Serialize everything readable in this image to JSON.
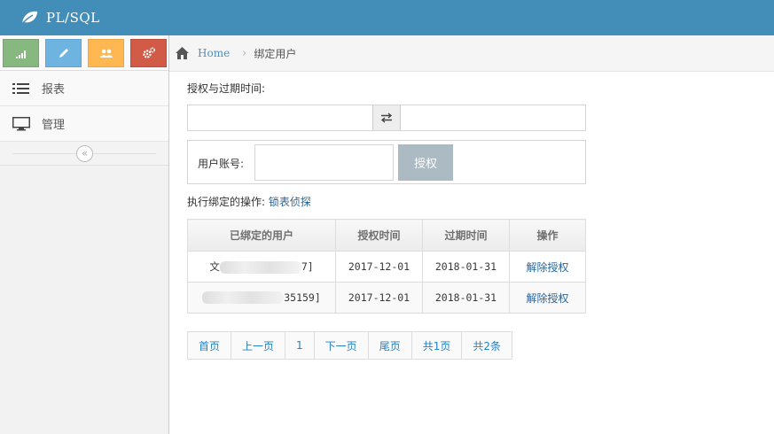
{
  "app": {
    "brand": "PL/SQL"
  },
  "shortcuts": [
    {
      "icon": "signal-icon",
      "color": "#87b87f"
    },
    {
      "icon": "pencil-icon",
      "color": "#6fb3e0"
    },
    {
      "icon": "users-icon",
      "color": "#ffb752"
    },
    {
      "icon": "cogs-icon",
      "color": "#d15b47"
    }
  ],
  "sidebar": {
    "items": [
      {
        "label": "报表",
        "icon": "list-icon"
      },
      {
        "label": "管理",
        "icon": "desktop-icon"
      }
    ]
  },
  "breadcrumb": {
    "home": "Home",
    "current": "绑定用户"
  },
  "form": {
    "auth_label": "授权与过期时间:",
    "start_value": "",
    "end_value": "",
    "account_label": "用户账号:",
    "account_value": "",
    "auth_button": "授权",
    "bind_label": "执行绑定的操作:",
    "bind_link": "锁表侦探"
  },
  "table": {
    "headers": [
      "已绑定的用户",
      "授权时间",
      "过期时间",
      "操作"
    ],
    "rows": [
      {
        "user_prefix": "文",
        "user_suffix": "7]",
        "auth_date": "2017-12-01",
        "expire_date": "2018-01-31",
        "action": "解除授权"
      },
      {
        "user_prefix": "",
        "user_suffix": "35159]",
        "auth_date": "2017-12-01",
        "expire_date": "2018-01-31",
        "action": "解除授权"
      }
    ]
  },
  "pager": {
    "first": "首页",
    "prev": "上一页",
    "page": "1",
    "next": "下一页",
    "last": "尾页",
    "total_pages": "共1页",
    "total_records": "共2条"
  }
}
